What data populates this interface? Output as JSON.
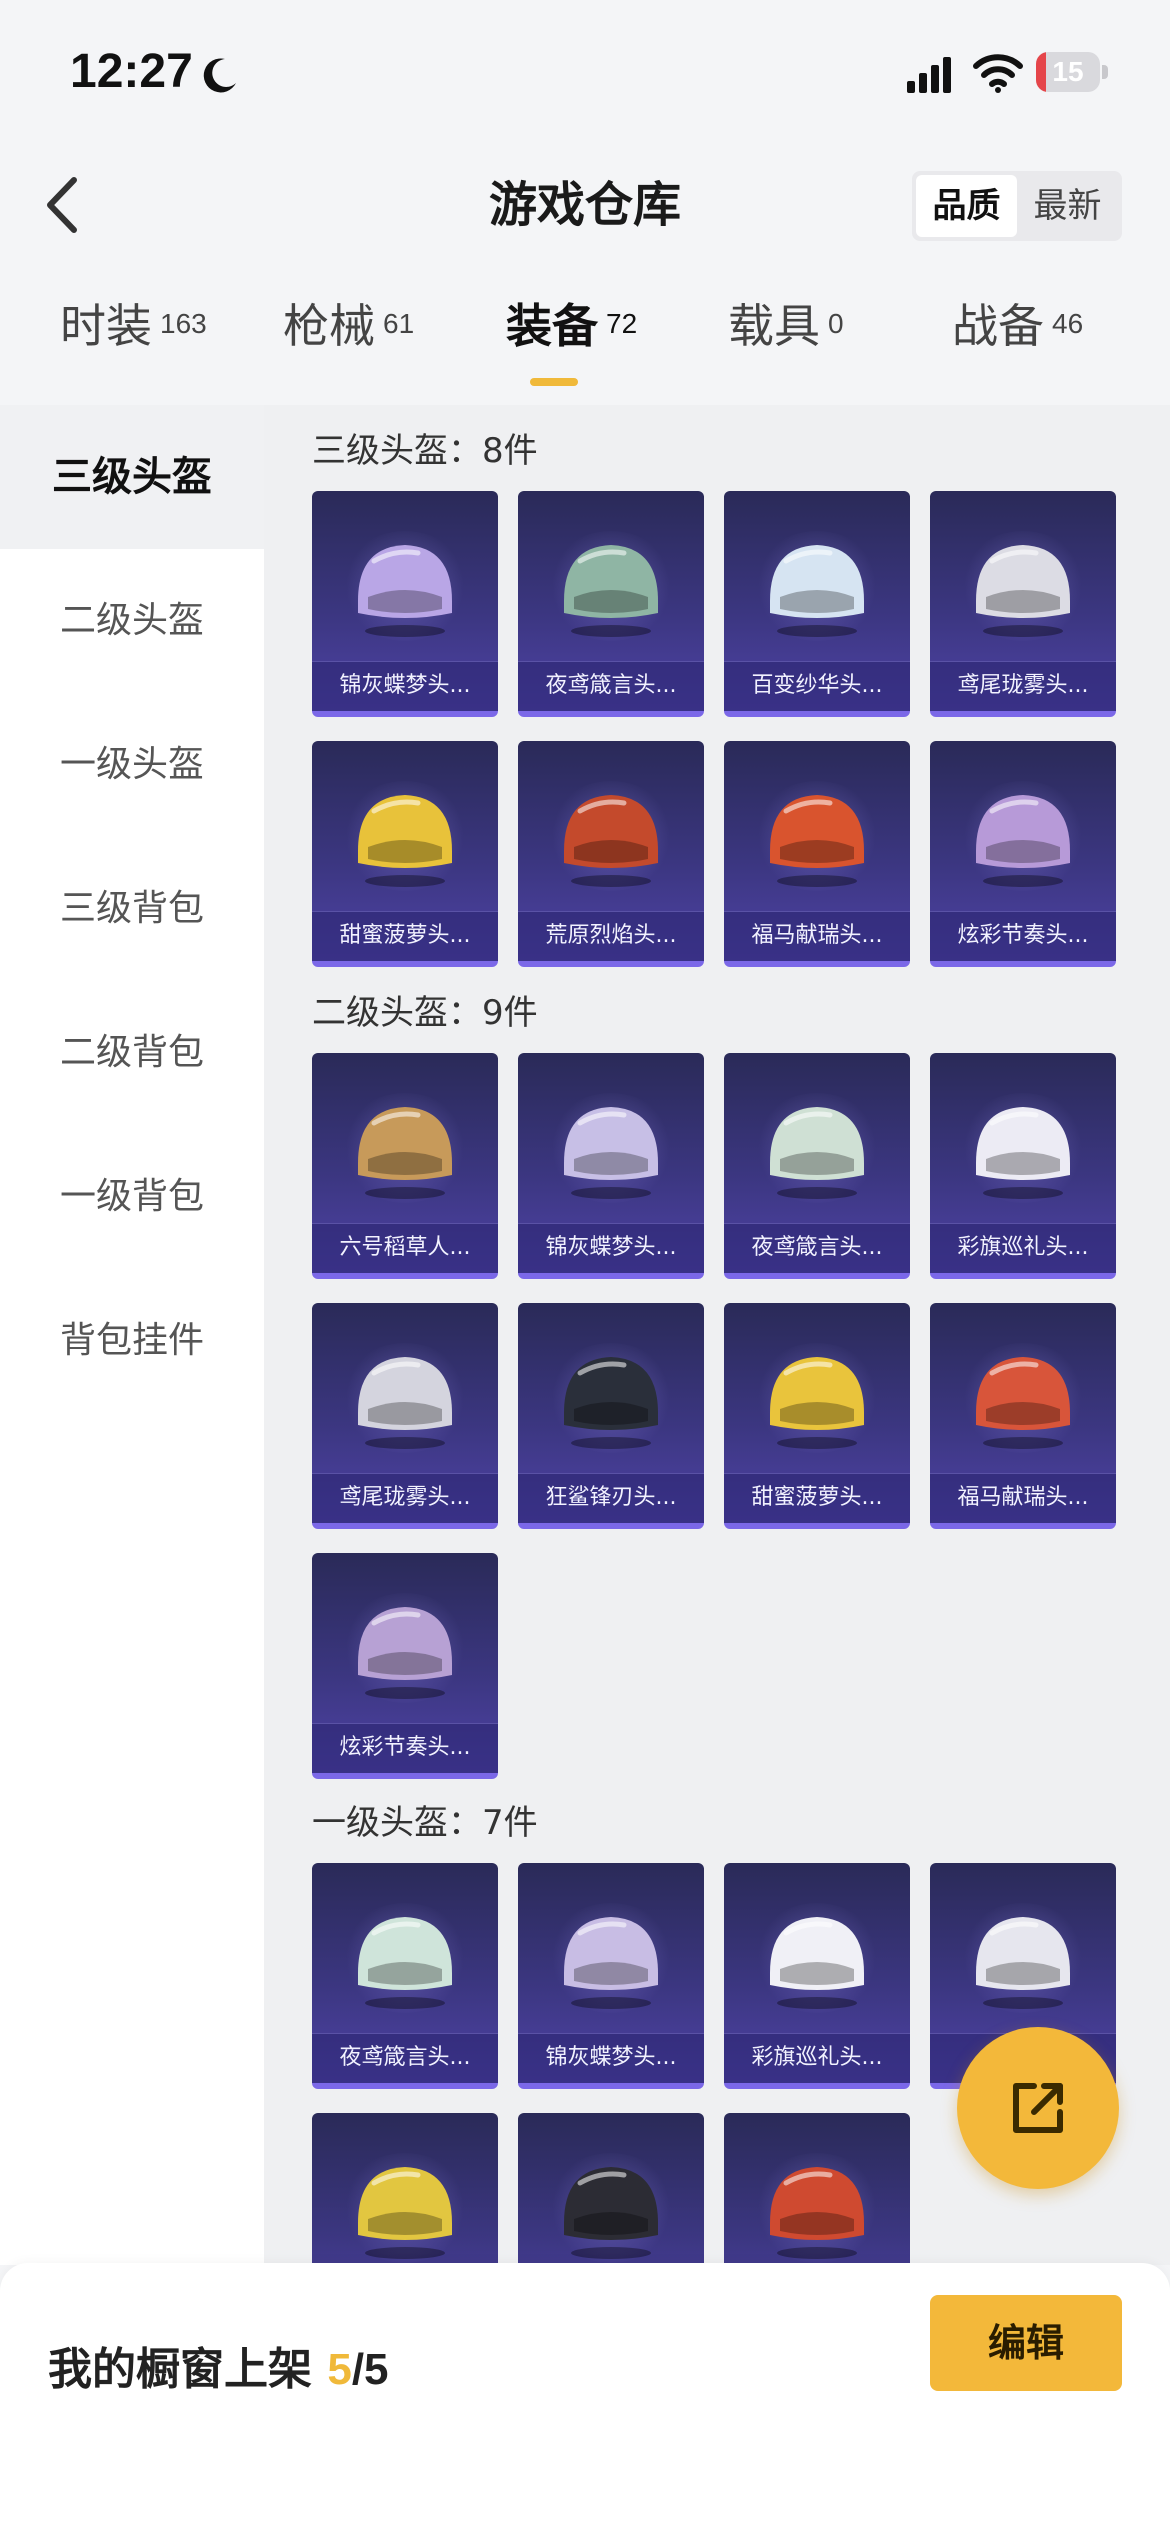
{
  "status_bar": {
    "time": "12:27",
    "battery": "15",
    "battery_level": 0.15
  },
  "header": {
    "title": "游戏仓库",
    "sort_active": "品质",
    "sort_inactive": "最新"
  },
  "category_tabs": [
    {
      "label": "时装",
      "count": "163",
      "active": false
    },
    {
      "label": "枪械",
      "count": "61",
      "active": false
    },
    {
      "label": "装备",
      "count": "72",
      "active": true
    },
    {
      "label": "载具",
      "count": "0",
      "active": false
    },
    {
      "label": "战备",
      "count": "46",
      "active": false
    }
  ],
  "sidebar": {
    "items": [
      "三级头盔",
      "二级头盔",
      "一级头盔",
      "三级背包",
      "二级背包",
      "一级背包",
      "背包挂件"
    ],
    "active_index": 0
  },
  "sections": [
    {
      "title": "三级头盔：8件",
      "items": [
        {
          "name": "锦灰蝶梦头...",
          "color": "#b9a6e6"
        },
        {
          "name": "夜鸢箴言头...",
          "color": "#8fb5a4"
        },
        {
          "name": "百变纱华头...",
          "color": "#d6e4f2"
        },
        {
          "name": "鸢尾珑雾头...",
          "color": "#dcdce4"
        },
        {
          "name": "甜蜜菠萝头...",
          "color": "#e8c23a"
        },
        {
          "name": "荒原烈焰头...",
          "color": "#c44a2c"
        },
        {
          "name": "福马献瑞头...",
          "color": "#d9542e"
        },
        {
          "name": "炫彩节奏头...",
          "color": "#b79ad8"
        }
      ]
    },
    {
      "title": "二级头盔：9件",
      "items": [
        {
          "name": "六号稻草人...",
          "color": "#c79a5a"
        },
        {
          "name": "锦灰蝶梦头...",
          "color": "#c7bfe6"
        },
        {
          "name": "夜鸢箴言头...",
          "color": "#cfe0d4"
        },
        {
          "name": "彩旗巡礼头...",
          "color": "#ecebf4"
        },
        {
          "name": "鸢尾珑雾头...",
          "color": "#d4d4de"
        },
        {
          "name": "狂鲨锋刃头...",
          "color": "#2a2f3a"
        },
        {
          "name": "甜蜜菠萝头...",
          "color": "#e9c43c"
        },
        {
          "name": "福马献瑞头...",
          "color": "#d8553a"
        },
        {
          "name": "炫彩节奏头...",
          "color": "#b7a1d4"
        }
      ]
    },
    {
      "title": "一级头盔：7件",
      "items": [
        {
          "name": "夜鸢箴言头...",
          "color": "#cfe4da"
        },
        {
          "name": "锦灰蝶梦头...",
          "color": "#c8bde4"
        },
        {
          "name": "彩旗巡礼头...",
          "color": "#f0f0f6"
        },
        {
          "name": "",
          "color": "#e6e6ee"
        },
        {
          "name": "",
          "color": "#e2c640"
        },
        {
          "name": "",
          "color": "#2c2c34"
        },
        {
          "name": "",
          "color": "#cf4a30"
        }
      ]
    }
  ],
  "bottom_bar": {
    "shelf_label": "我的橱窗上架 ",
    "shelf_current": "5",
    "shelf_sep": "/",
    "shelf_total": "5",
    "edit_label": "编辑"
  }
}
